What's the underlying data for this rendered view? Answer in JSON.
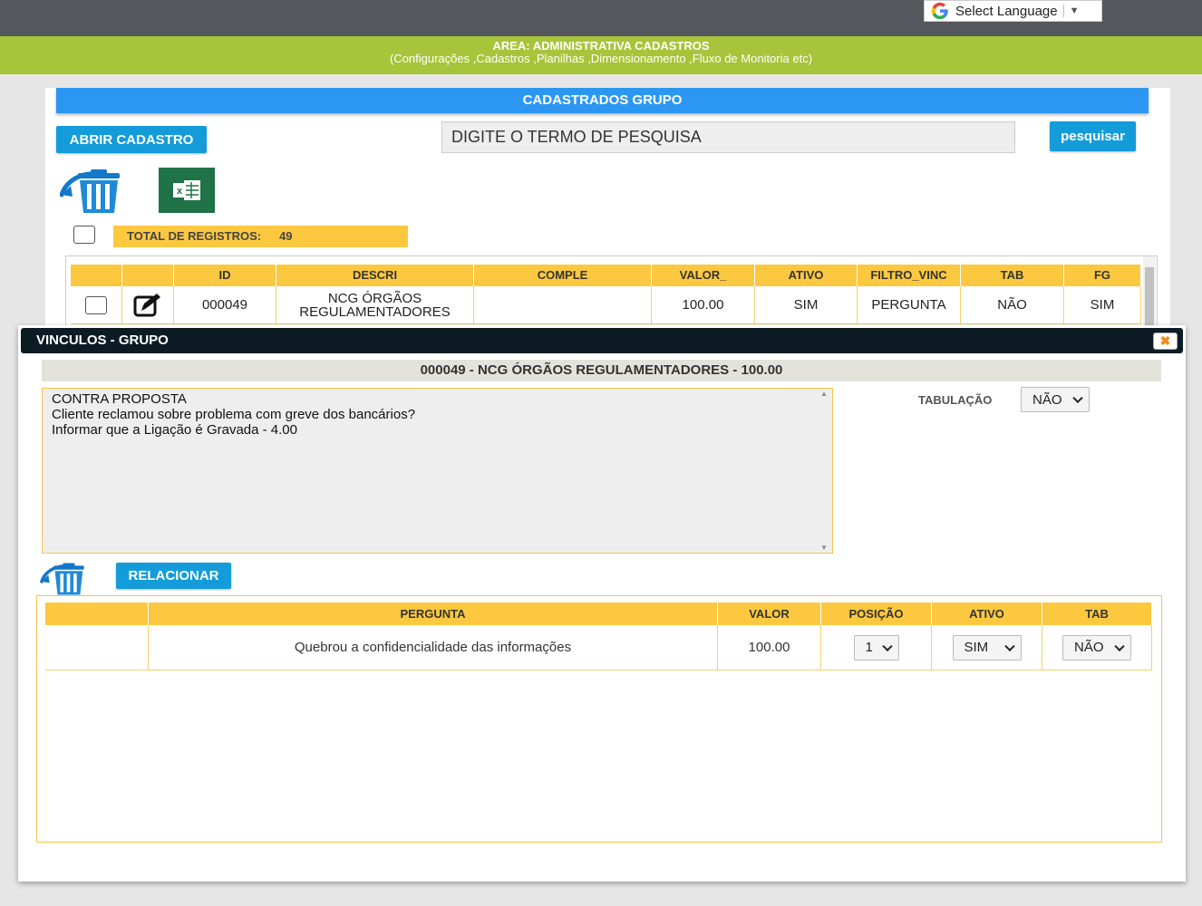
{
  "topbar": {
    "language_label": "Select Language",
    "language_arrow": "▼"
  },
  "area": {
    "title": "AREA: ADMINISTRATIVA CADASTROS",
    "subtitle": "(Configurações ,Cadastros ,Planilhas ,Dimensionamento ,Fluxo de Monitoria etc)"
  },
  "main": {
    "header": "CADASTRADOS GRUPO",
    "open_button": "ABRIR CADASTRO",
    "search_placeholder": "DIGITE O TERMO DE PESQUISA",
    "search_button": "pesquisar",
    "total_label": "TOTAL DE REGISTROS:",
    "total_value": "49",
    "columns": [
      "",
      "",
      "ID",
      "DESCRI",
      "COMPLE",
      "VALOR_",
      "ATIVO",
      "FILTRO_VINC",
      "TAB",
      "FG"
    ],
    "rows": [
      {
        "id": "000049",
        "descri": "NCG ÓRGÃOS REGULAMENTADORES",
        "comple": "",
        "valor": "100.00",
        "ativo": "SIM",
        "filtro_vinc": "PERGUNTA",
        "tab": "NÃO",
        "fg": "SIM"
      }
    ]
  },
  "modal": {
    "title": "VINCULOS - GRUPO",
    "close_label": "✖",
    "subtitle": "000049 - NCG ÓRGÃOS REGULAMENTADORES - 100.00",
    "text": "CONTRA PROPOSTA\nCliente reclamou sobre problema com greve dos bancários?\nInformar que a Ligação é Gravada - 4.00",
    "tabulacao_label": "TABULAÇÃO",
    "tabulacao_value": "NÃO",
    "relacionar_button": "RELACIONAR",
    "columns": [
      "",
      "PERGUNTA",
      "VALOR",
      "POSIÇÃO",
      "ATIVO",
      "TAB"
    ],
    "rows": [
      {
        "pergunta": "Quebrou a confidencialidade das informações",
        "valor": "100.00",
        "posicao": "1",
        "ativo": "SIM",
        "tab": "NÃO"
      }
    ]
  },
  "icons": {
    "language": "google-g-icon",
    "delete": "trash-icon",
    "export": "excel-icon",
    "edit": "edit-icon",
    "close": "close-icon"
  },
  "colors": {
    "accent_blue": "#2c97f2",
    "button_blue": "#139cd9",
    "header_yellow": "#fcc83f",
    "green_band": "#a8c43a",
    "dark_bar": "#54575c",
    "modal_title": "#0d1b24"
  }
}
